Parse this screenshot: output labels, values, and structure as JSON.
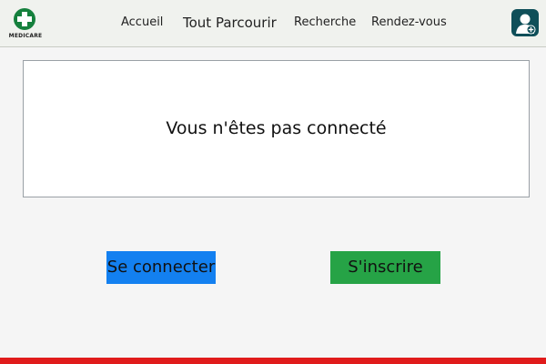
{
  "header": {
    "logo_text": "MEDICARE",
    "nav": [
      "Accueil",
      "Tout Parcourir",
      "Recherche",
      "Rendez-vous"
    ]
  },
  "main": {
    "message": "Vous n'êtes pas connecté"
  },
  "actions": {
    "login_label": "Se connecter",
    "signup_label": "S'inscrire"
  },
  "colors": {
    "brand": "#15803d",
    "login": "#1380f0",
    "signup": "#26a346",
    "footer_bar": "#e01b1b"
  }
}
